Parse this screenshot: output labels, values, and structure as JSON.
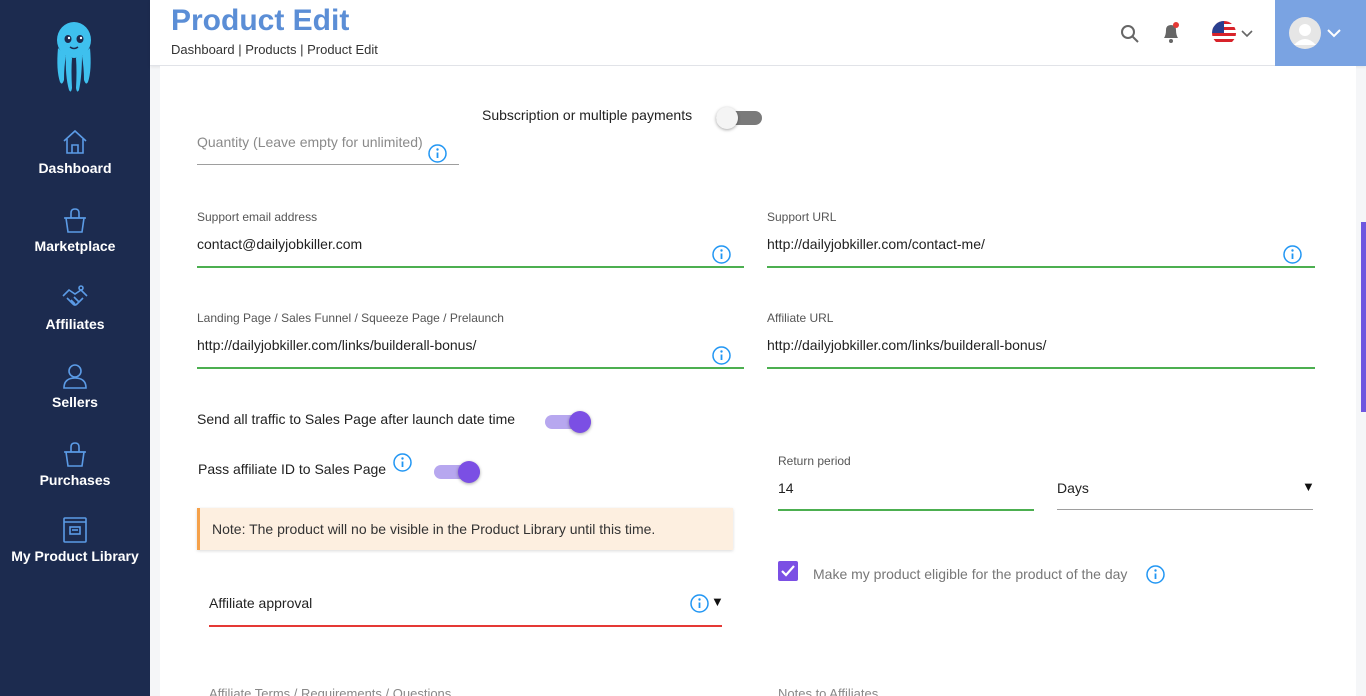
{
  "header": {
    "title": "Product Edit",
    "breadcrumb": "Dashboard | Products | Product Edit"
  },
  "sidebar": {
    "items": [
      {
        "label": "Dashboard",
        "icon": "home-icon"
      },
      {
        "label": "Marketplace",
        "icon": "bag-icon"
      },
      {
        "label": "Affiliates",
        "icon": "handshake-icon"
      },
      {
        "label": "Sellers",
        "icon": "user-icon"
      },
      {
        "label": "Purchases",
        "icon": "bag-icon"
      },
      {
        "label": "My Product Library",
        "icon": "book-icon"
      }
    ]
  },
  "form": {
    "subscription_label": "Subscription or multiple payments",
    "subscription_on": false,
    "quantity_placeholder": "Quantity (Leave empty for unlimited)",
    "support_email": {
      "label": "Support email address",
      "value": "contact@dailyjobkiller.com"
    },
    "support_url": {
      "label": "Support URL",
      "value": "http://dailyjobkiller.com/contact-me/"
    },
    "landing_page": {
      "label": "Landing Page / Sales Funnel / Squeeze Page / Prelaunch",
      "value": "http://dailyjobkiller.com/links/builderall-bonus/"
    },
    "affiliate_url": {
      "label": "Affiliate URL",
      "value": "http://dailyjobkiller.com/links/builderall-bonus/"
    },
    "send_traffic_label": "Send all traffic to Sales Page after launch date time",
    "send_traffic_on": true,
    "pass_affiliate_label": "Pass affiliate ID to Sales Page",
    "pass_affiliate_on": true,
    "note": "Note: The product will no be visible in the Product Library until this time.",
    "return_period": {
      "label": "Return period",
      "value": "14",
      "unit": "Days"
    },
    "product_of_day_label": "Make my product eligible for the product of the day",
    "product_of_day_checked": true,
    "affiliate_approval_label": "Affiliate approval",
    "affiliate_terms_label": "Affiliate Terms / Requirements / Questions",
    "notes_affiliates_label": "Notes to Affiliates"
  },
  "colors": {
    "sidebar_bg": "#1c2b4f",
    "accent_blue": "#5b8ed6",
    "valid_green": "#4caf50",
    "error_red": "#e53935",
    "purple": "#7b4fe4",
    "info_blue": "#2196f3"
  }
}
